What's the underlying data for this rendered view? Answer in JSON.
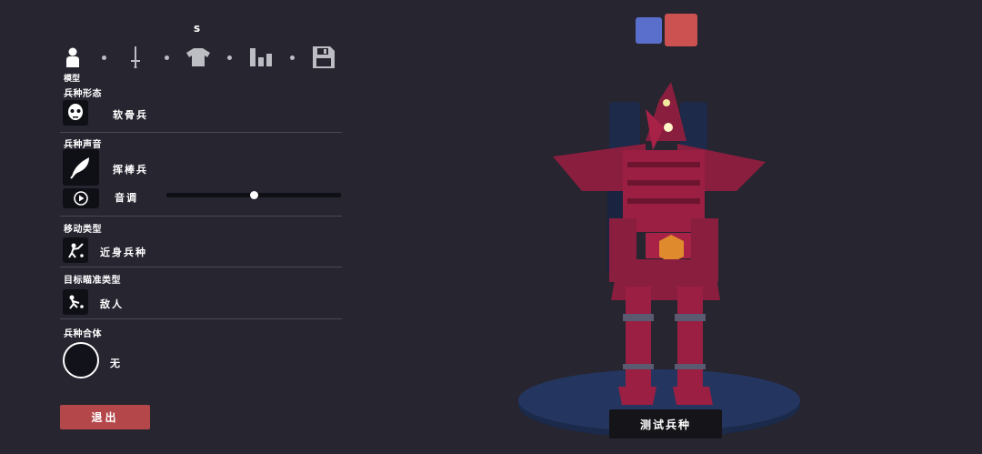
{
  "toolbar": {
    "hotkey_label": "s",
    "tabs": [
      {
        "icon": "person-icon"
      },
      {
        "icon": "sword-icon"
      },
      {
        "icon": "shirt-icon"
      },
      {
        "icon": "bar-chart-icon"
      },
      {
        "icon": "save-icon"
      }
    ],
    "active_tab_caption": "模型"
  },
  "form": {
    "unit_form": {
      "title": "兵种形态",
      "icon": "skull-mask-icon",
      "value": "软骨兵"
    },
    "unit_voice": {
      "title": "兵种声音",
      "icon": "feather-icon",
      "value": "挥棒兵",
      "pitch_label": "音调",
      "pitch_level": 0.5,
      "play_icon": "play-icon"
    },
    "movement_type": {
      "title": "移动类型",
      "icon": "melee-unit-icon",
      "value": "近身兵种"
    },
    "targeting_type": {
      "title": "目标瞄准类型",
      "icon": "target-enemy-icon",
      "value": "敌人"
    },
    "unit_fusion": {
      "title": "兵种合体",
      "value": "无"
    }
  },
  "actions": {
    "exit_label": "退出",
    "test_label": "测试兵种"
  },
  "team_colors": {
    "blue": "#5a6ecc",
    "red": "#cc5252"
  }
}
